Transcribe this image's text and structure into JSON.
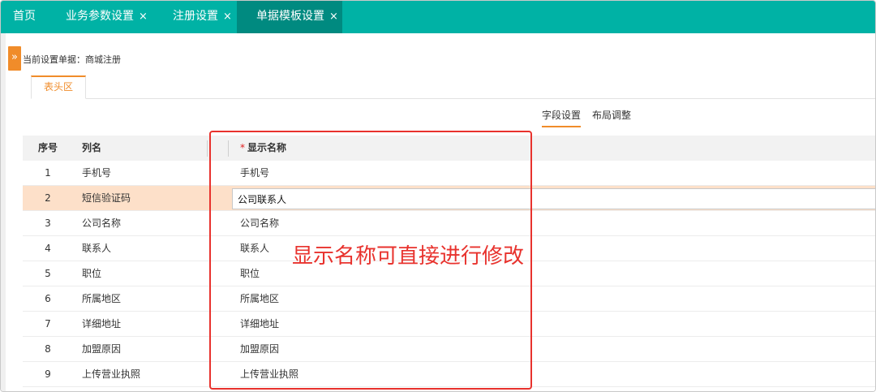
{
  "top_tabs": [
    {
      "label": "首页",
      "closable": false,
      "active": false
    },
    {
      "label": "业务参数设置",
      "closable": true,
      "active": false
    },
    {
      "label": "注册设置",
      "closable": true,
      "active": false
    },
    {
      "label": "单据模板设置",
      "closable": true,
      "active": true
    }
  ],
  "close_glyph": "×",
  "expand_icon": "»",
  "current_doc_label": "当前设置单据：商城注册",
  "sub_tab": "表头区",
  "switches": {
    "field": "字段设置",
    "layout": "布局调整"
  },
  "table": {
    "headers": {
      "index": "序号",
      "column": "列名",
      "required_mark": "*",
      "display": "显示名称"
    },
    "rows": [
      {
        "index": "1",
        "column": "手机号",
        "display": "手机号"
      },
      {
        "index": "2",
        "column": "短信验证码",
        "display": "公司联系人",
        "editing": true
      },
      {
        "index": "3",
        "column": "公司名称",
        "display": "公司名称"
      },
      {
        "index": "4",
        "column": "联系人",
        "display": "联系人"
      },
      {
        "index": "5",
        "column": "职位",
        "display": "职位"
      },
      {
        "index": "6",
        "column": "所属地区",
        "display": "所属地区"
      },
      {
        "index": "7",
        "column": "详细地址",
        "display": "详细地址"
      },
      {
        "index": "8",
        "column": "加盟原因",
        "display": "加盟原因"
      },
      {
        "index": "9",
        "column": "上传营业执照",
        "display": "上传营业执照"
      }
    ]
  },
  "annotation": "显示名称可直接进行修改",
  "colors": {
    "teal": "#00b2a5",
    "teal_active": "#008a80",
    "orange": "#f08c2a",
    "selected_row": "#fde0c9",
    "annotation_red": "#e8322d"
  }
}
